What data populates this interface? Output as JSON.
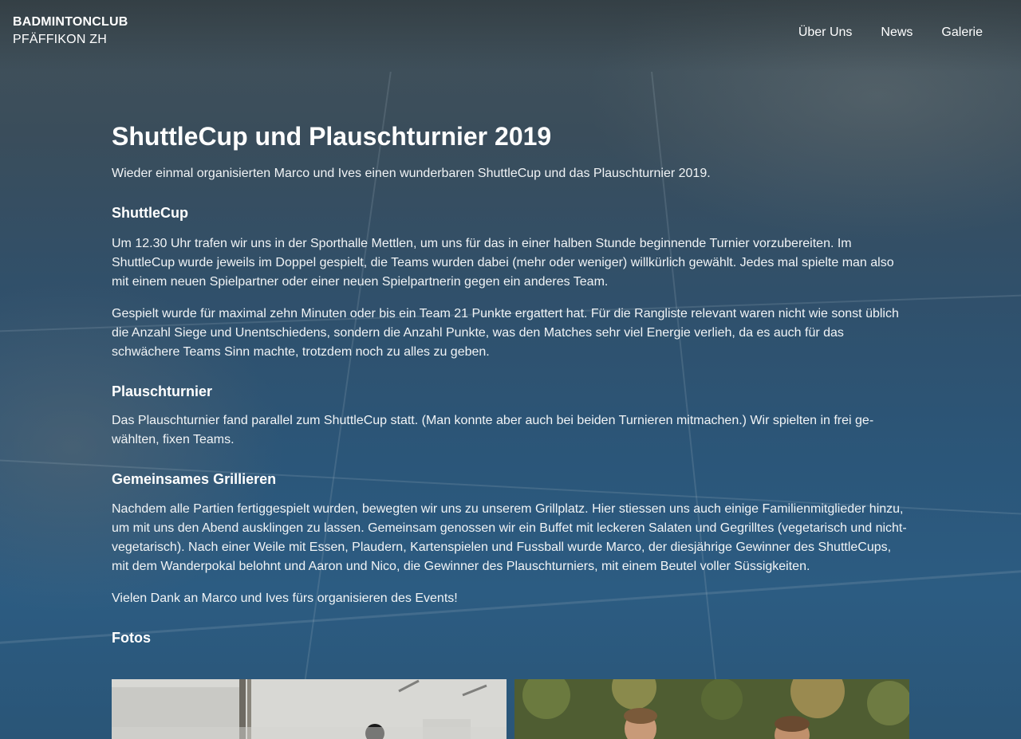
{
  "brand": {
    "line1": "BADMINTONCLUB",
    "line2": "PFÄFFIKON ZH"
  },
  "nav": {
    "items": [
      "Über Uns",
      "News",
      "Galerie"
    ]
  },
  "article": {
    "title": "ShuttleCup und Plauschturnier 2019",
    "intro": "Wieder einmal organisierten Marco und Ives einen wunderbaren ShuttleCup und das Plauschturnier 2019.",
    "sections": [
      {
        "heading": "ShuttleCup",
        "paragraphs": [
          "Um 12.30 Uhr trafen wir uns in der Sporthalle Mettlen, um uns für das in einer halben Stunde beginnende Turnier vorzubereiten. Im ShuttleCup wurde jeweils im Doppel gespielt, die Teams wurden dabei (mehr oder weniger) willkürlich gewählt. Jedes mal spielte man also mit einem neuen Spielpartner oder einer neuen Spielpartnerin gegen ein anderes Team.",
          "Gespielt wurde für maximal zehn Minuten oder bis ein Team 21 Punkte ergattert hat. Für die Rangliste relevant waren nicht wie sonst üb­lich die Anzahl Siege und Unentschiedens, sondern die Anzahl Punkte, was den Matches sehr viel Energie verlieh, da es auch für das schwächere Teams Sinn machte, trotzdem noch zu alles zu geben."
        ]
      },
      {
        "heading": "Plauschturnier",
        "paragraphs": [
          "Das Plauschturnier fand parallel zum ShuttleCup statt. (Man konnte aber auch bei beiden Turnieren mitmachen.) Wir spielten in frei ge­wählten, fixen Teams."
        ]
      },
      {
        "heading": "Gemeinsames Grillieren",
        "paragraphs": [
          "Nachdem alle Partien fertiggespielt wurden, bewegten wir uns zu unserem Grillplatz. Hier stiessen uns auch einige Familienmitglieder hinzu, um mit uns den Abend ausklingen zu lassen. Gemeinsam genossen wir ein Buffet mit leckeren Salaten und Gegrilltes (vegetarisch und nicht-vegetarisch). Nach einer Weile mit Essen, Plaudern, Kartenspielen und Fussball wurde Marco, der diesjährige Gewinner des ShuttleCups, mit dem Wanderpokal belohnt und Aaron und Nico, die Gewinner des Plauschturniers, mit einem Beutel voller Süssigkei­ten.",
          "Vielen Dank an Marco und Ives fürs organisieren des Events!"
        ]
      },
      {
        "heading": "Fotos",
        "paragraphs": []
      }
    ]
  },
  "colors": {
    "text": "#ffffff",
    "background": "#2b5679"
  }
}
